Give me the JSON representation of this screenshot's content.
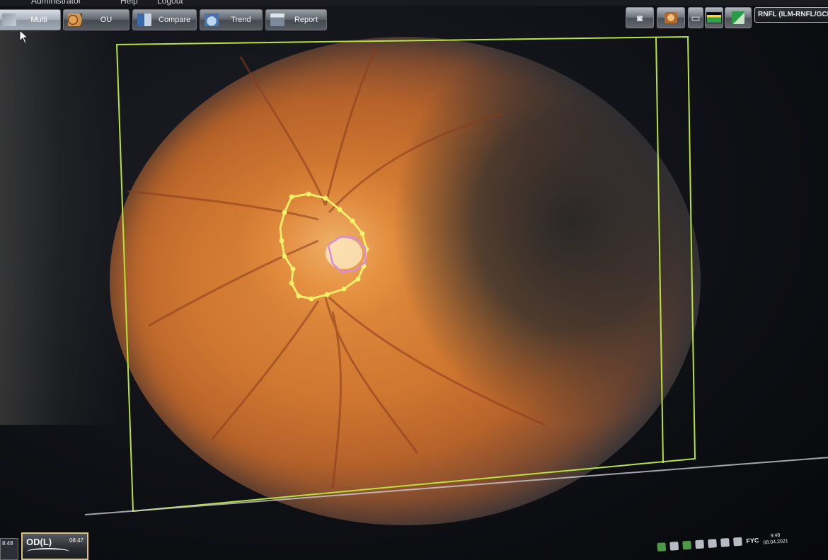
{
  "menubar": {
    "items": [
      "Administrator",
      "Help",
      "Logout"
    ]
  },
  "toolbar": {
    "buttons": [
      {
        "label": "Multi",
        "icon": "multi-view-icon"
      },
      {
        "label": "OU",
        "icon": "ou-eyes-icon"
      },
      {
        "label": "Compare",
        "icon": "compare-icon"
      },
      {
        "label": "Trend",
        "icon": "trend-icon"
      },
      {
        "label": "Report",
        "icon": "report-icon"
      }
    ],
    "right_buttons": [
      {
        "icon": "camera-icon"
      },
      {
        "icon": "fundus-image-icon"
      },
      {
        "icon": "blank-panel-icon"
      },
      {
        "icon": "thickness-map-icon"
      },
      {
        "icon": "edit-segmentation-icon"
      }
    ],
    "layer_select_value": "RNFL (ILM-RNFL/GCL)"
  },
  "viewer": {
    "frame_color": "#b7e33a",
    "disc_outline_color": "#f4f26a",
    "cup_outline_color": "#d98be0"
  },
  "bottom": {
    "thumb_small_label": "8:48",
    "thumb_tab": {
      "eye": "OD(L)",
      "time": "08:47"
    }
  },
  "taskbar": {
    "language": "FYC",
    "time": "9:48",
    "date": "08.04.2021"
  }
}
